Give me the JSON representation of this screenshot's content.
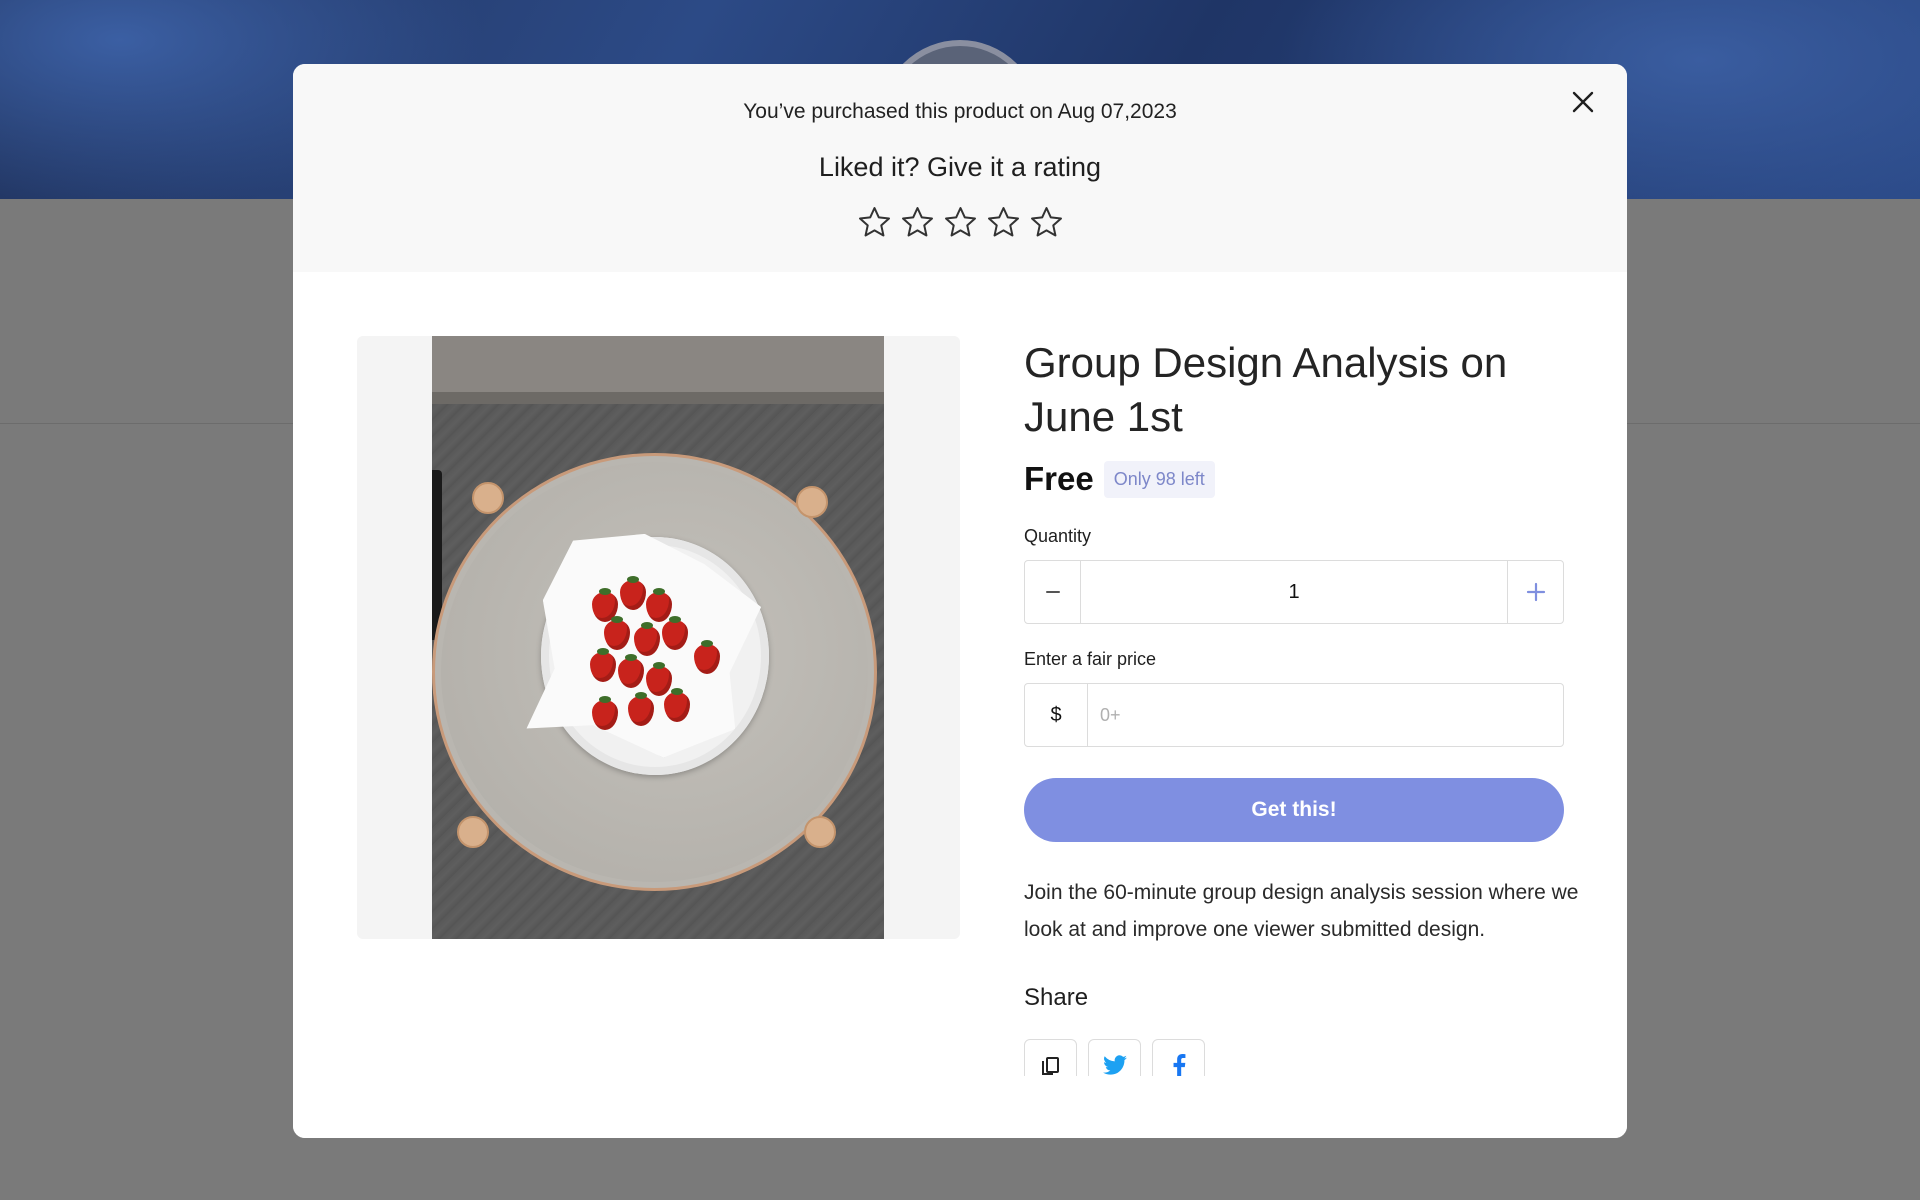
{
  "header": {
    "purchase_note": "You’ve purchased this product on Aug 07,2023",
    "rating_prompt": "Liked it? Give it a rating",
    "star_count": 5,
    "current_rating": 0
  },
  "product": {
    "title": "Group Design Analysis on June 1st",
    "price": "Free",
    "stock_badge": "Only 98 left",
    "quantity_label": "Quantity",
    "quantity_value": "1",
    "fair_price_label": "Enter a fair price",
    "currency_symbol": "$",
    "price_placeholder": "0+",
    "cta_label": "Get this!",
    "description": "Join the 60-minute group design analysis session where we look at and improve one viewer submitted design.",
    "share_label": "Share"
  },
  "share_buttons": [
    {
      "icon": "copy-link-icon"
    },
    {
      "icon": "twitter-icon"
    },
    {
      "icon": "facebook-icon"
    }
  ],
  "colors": {
    "accent": "#7f8fe1",
    "badge_text": "#7d87c9",
    "badge_bg": "#f1f2fa",
    "twitter": "#1da1f2",
    "facebook": "#1877f2"
  }
}
